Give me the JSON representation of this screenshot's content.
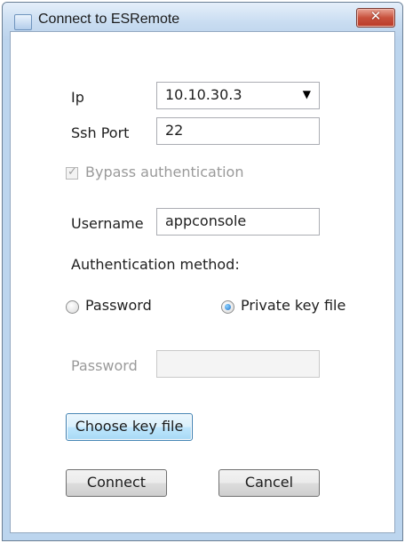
{
  "window": {
    "title": "Connect to ESRemote",
    "close_glyph": "✕"
  },
  "form": {
    "ip_label": "Ip",
    "ip_value": "10.10.30.3",
    "ssh_port_label": "Ssh Port",
    "ssh_port_value": "22",
    "bypass_label": "Bypass authentication",
    "bypass_checked": true,
    "username_label": "Username",
    "username_value": "appconsole",
    "auth_method_label": "Authentication method:",
    "radio_password_label": "Password",
    "radio_privatekey_label": "Private key file",
    "selected_auth": "Private key file",
    "password_label": "Password",
    "password_value": "",
    "choose_key_label": "Choose key file",
    "connect_label": "Connect",
    "cancel_label": "Cancel"
  },
  "icons": {
    "app": "app-icon",
    "close": "close-icon",
    "dropdown": "dropdown-arrow-icon",
    "check": "check-icon"
  },
  "colors": {
    "frame": "#bcd5ee",
    "close_button": "#c8513d",
    "focus_border": "#3c7fb1"
  }
}
